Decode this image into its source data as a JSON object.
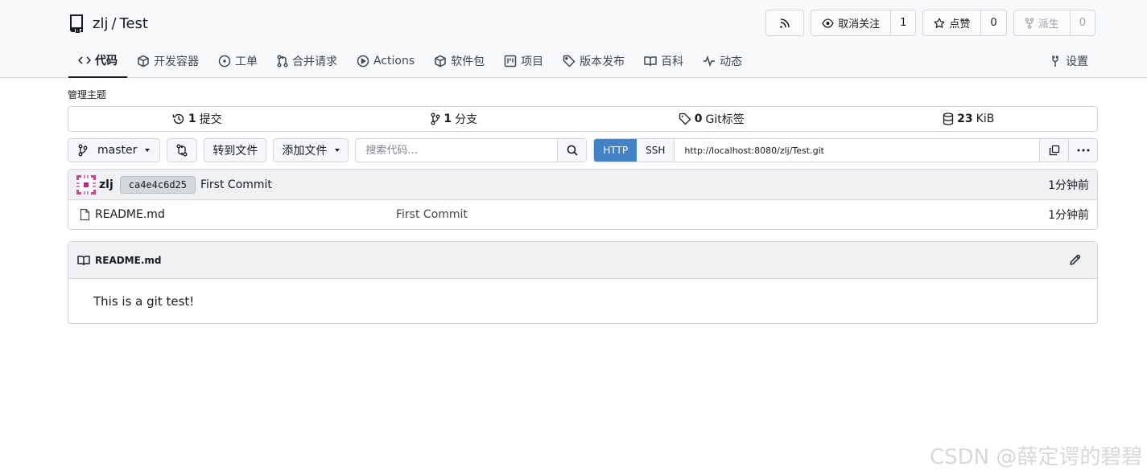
{
  "repo": {
    "owner": "zlj",
    "separator": "/",
    "name": "Test"
  },
  "actions": {
    "watch_label": "取消关注",
    "watch_count": "1",
    "star_label": "点赞",
    "star_count": "0",
    "fork_label": "派生",
    "fork_count": "0"
  },
  "tabs": [
    {
      "label": "代码",
      "icon": "code-icon"
    },
    {
      "label": "开发容器",
      "icon": "package-box-icon"
    },
    {
      "label": "工单",
      "icon": "issue-opened-icon"
    },
    {
      "label": "合并请求",
      "icon": "git-pull-request-icon"
    },
    {
      "label": "Actions",
      "icon": "play-icon"
    },
    {
      "label": "软件包",
      "icon": "package-icon"
    },
    {
      "label": "项目",
      "icon": "project-icon"
    },
    {
      "label": "版本发布",
      "icon": "tag-icon"
    },
    {
      "label": "百科",
      "icon": "book-icon"
    },
    {
      "label": "动态",
      "icon": "pulse-icon"
    }
  ],
  "settings_label": "设置",
  "topics_label": "管理主题",
  "stats": {
    "commits_count": "1",
    "commits_label": "提交",
    "branches_count": "1",
    "branches_label": "分支",
    "tags_count": "0",
    "tags_label": "Git标签",
    "size_count": "23",
    "size_unit": "KiB"
  },
  "toolbar": {
    "branch": "master",
    "goto_file": "转到文件",
    "add_file": "添加文件",
    "search_placeholder": "搜索代码...",
    "proto_http": "HTTP",
    "proto_ssh": "SSH",
    "clone_url": "http://localhost:8080/zlj/Test.git"
  },
  "latest_commit": {
    "author": "zlj",
    "sha": "ca4e4c6d25",
    "message": "First Commit",
    "time": "1分钟前"
  },
  "files": [
    {
      "name": "README.md",
      "message": "First Commit",
      "time": "1分钟前"
    }
  ],
  "readme": {
    "title": "README.md",
    "content": "This is a git test!"
  },
  "watermark": "CSDN @薛定谔的碧碧"
}
